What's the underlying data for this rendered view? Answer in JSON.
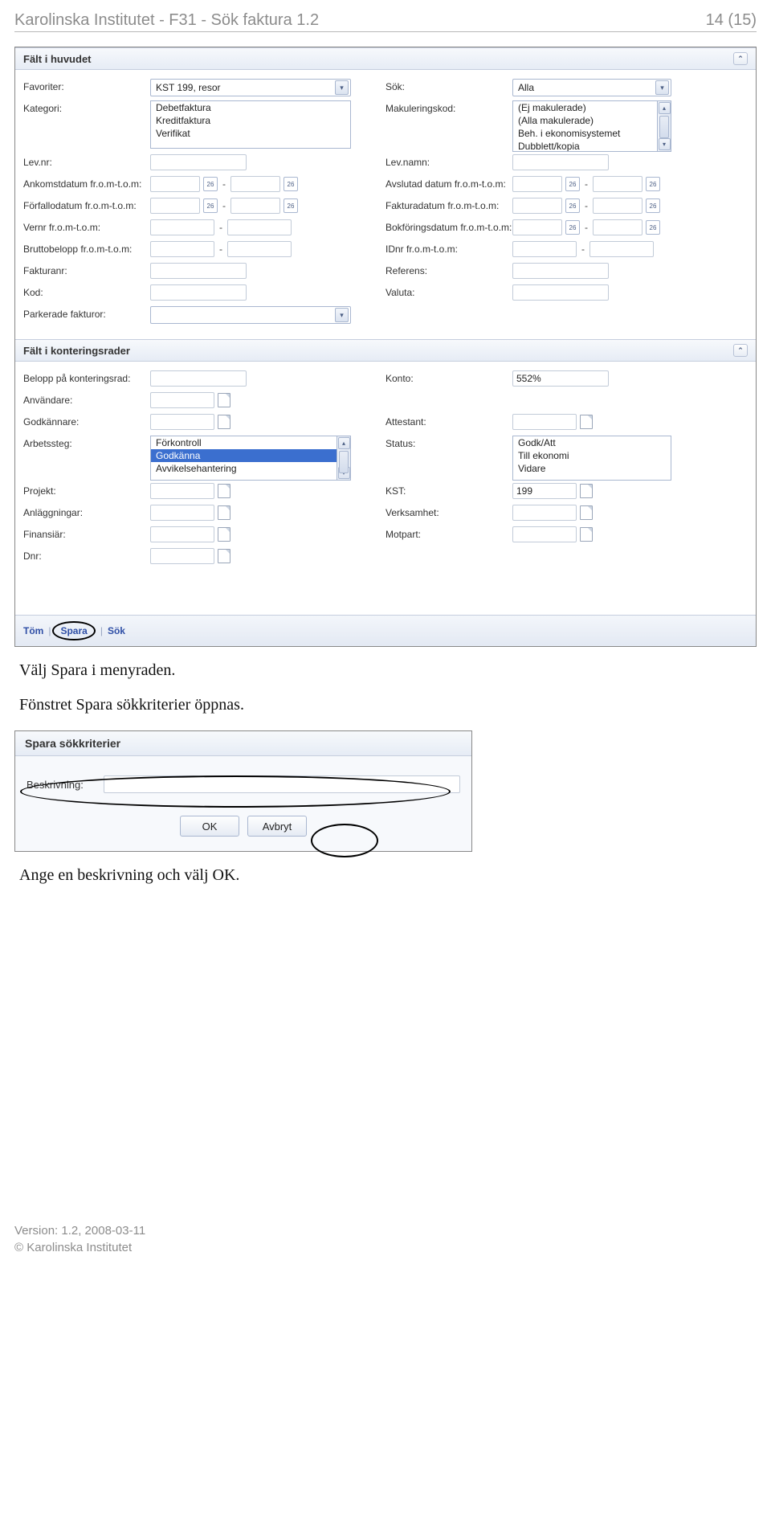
{
  "doc_header": {
    "title": "Karolinska Institutet - F31 - Sök faktura 1.2",
    "page": "14 (15)"
  },
  "section1": {
    "title": "Fält i huvudet"
  },
  "form1": {
    "favoriter": {
      "label": "Favoriter:",
      "value": "KST 199, resor"
    },
    "sok": {
      "label": "Sök:",
      "value": "Alla"
    },
    "kategori": {
      "label": "Kategori:",
      "items": [
        "Debetfaktura",
        "Kreditfaktura",
        "Verifikat"
      ]
    },
    "makulkod": {
      "label": "Makuleringskod:",
      "items": [
        "(Ej makulerade)",
        "(Alla makulerade)",
        "Beh. i ekonomisystemet",
        "Dubblett/kopia"
      ]
    },
    "levnr": {
      "label": "Lev.nr:"
    },
    "levnamn": {
      "label": "Lev.namn:"
    },
    "ankomst": {
      "label": "Ankomstdatum fr.o.m-t.o.m:"
    },
    "avslut": {
      "label": "Avslutad datum fr.o.m-t.o.m:"
    },
    "forfall": {
      "label": "Förfallodatum fr.o.m-t.o.m:"
    },
    "faktura": {
      "label": "Fakturadatum fr.o.m-t.o.m:"
    },
    "vernr": {
      "label": "Vernr fr.o.m-t.o.m:"
    },
    "bokfor": {
      "label": "Bokföringsdatum fr.o.m-t.o.m:"
    },
    "brutto": {
      "label": "Bruttobelopp fr.o.m-t.o.m:"
    },
    "idnr": {
      "label": "IDnr fr.o.m-t.o.m:"
    },
    "fakturanr": {
      "label": "Fakturanr:"
    },
    "referens": {
      "label": "Referens:"
    },
    "kod": {
      "label": "Kod:"
    },
    "valuta": {
      "label": "Valuta:"
    },
    "parkerade": {
      "label": "Parkerade fakturor:"
    }
  },
  "section2": {
    "title": "Fält i konteringsrader"
  },
  "form2": {
    "belopprad": {
      "label": "Belopp på konteringsrad:"
    },
    "konto": {
      "label": "Konto:",
      "value": "552%"
    },
    "anvandare": {
      "label": "Användare:"
    },
    "godkannare": {
      "label": "Godkännare:"
    },
    "attestant": {
      "label": "Attestant:"
    },
    "arbetssteg": {
      "label": "Arbetssteg:",
      "items": [
        "Förkontroll",
        "Godkänna",
        "Avvikelsehantering"
      ],
      "selected": "Godkänna"
    },
    "status": {
      "label": "Status:",
      "items": [
        "Godk/Att",
        "Till ekonomi",
        "Vidare"
      ]
    },
    "projekt": {
      "label": "Projekt:"
    },
    "kst": {
      "label": "KST:",
      "value": "199"
    },
    "anlaggn": {
      "label": "Anläggningar:"
    },
    "verks": {
      "label": "Verksamhet:"
    },
    "finans": {
      "label": "Finansiär:"
    },
    "motpart": {
      "label": "Motpart:"
    },
    "dnr": {
      "label": "Dnr:"
    }
  },
  "toolbar": {
    "tom": "Töm",
    "spara": "Spara",
    "sok": "Sök",
    "sep": "|"
  },
  "body": {
    "p1": "Välj Spara i menyraden.",
    "p2": "Fönstret Spara sökkriterier öppnas.",
    "p3": "Ange en beskrivning och välj OK."
  },
  "dialog": {
    "title": "Spara sökkriterier",
    "besk_label": "Beskrivning:",
    "ok": "OK",
    "avbryt": "Avbryt"
  },
  "footer": {
    "version": "Version: 1.2, 2008-03-11",
    "org": "© Karolinska Institutet"
  }
}
